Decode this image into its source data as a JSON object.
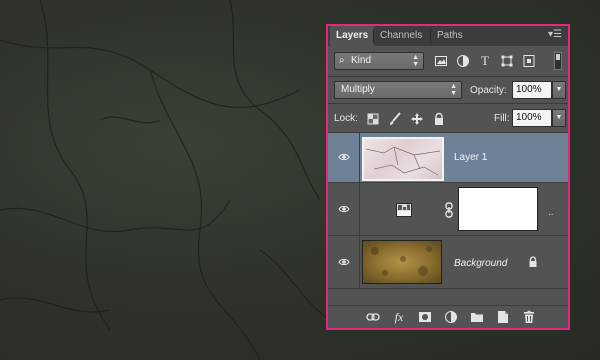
{
  "tabs": [
    {
      "label": "Layers",
      "active": true
    },
    {
      "label": "Channels",
      "active": false
    },
    {
      "label": "Paths",
      "active": false
    }
  ],
  "filter": {
    "kind_label": "Kind"
  },
  "blend": {
    "mode": "Multiply",
    "opacity_label": "Opacity:",
    "opacity_value": "100%"
  },
  "lock": {
    "label": "Lock:",
    "fill_label": "Fill:",
    "fill_value": "100%"
  },
  "layers": [
    {
      "name": "Layer 1",
      "selected": true,
      "visible": true
    },
    {
      "name": "",
      "selected": false,
      "visible": true,
      "type": "adjustment-with-mask"
    },
    {
      "name": "Background",
      "selected": false,
      "visible": true,
      "locked": true
    }
  ],
  "footer_icons": [
    "link-layers-icon",
    "fx-icon",
    "add-mask-icon",
    "adjustment-layer-icon",
    "new-group-icon",
    "new-layer-icon",
    "delete-layer-icon"
  ],
  "colors": {
    "accent_border": "#e6287a",
    "selected_row": "#6f8196",
    "panel_bg": "#535353"
  }
}
